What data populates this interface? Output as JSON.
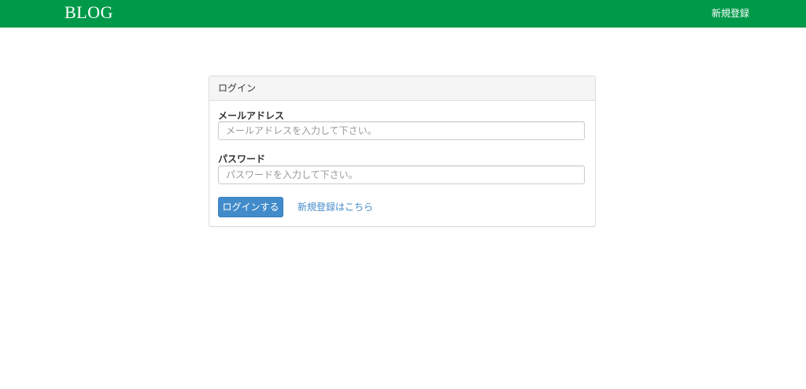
{
  "navbar": {
    "brand": "BLOG",
    "register_link": "新規登録",
    "color": "#00994a"
  },
  "login_panel": {
    "heading": "ログイン",
    "email": {
      "label": "メールアドレス",
      "value": "",
      "placeholder": "メールアドレスを入力して下さい。"
    },
    "password": {
      "label": "パスワード",
      "value": "",
      "placeholder": "パスワードを入力して下さい。"
    },
    "submit_button": "ログインする",
    "register_link": "新規登録はこちら",
    "button_color": "#428bca"
  }
}
